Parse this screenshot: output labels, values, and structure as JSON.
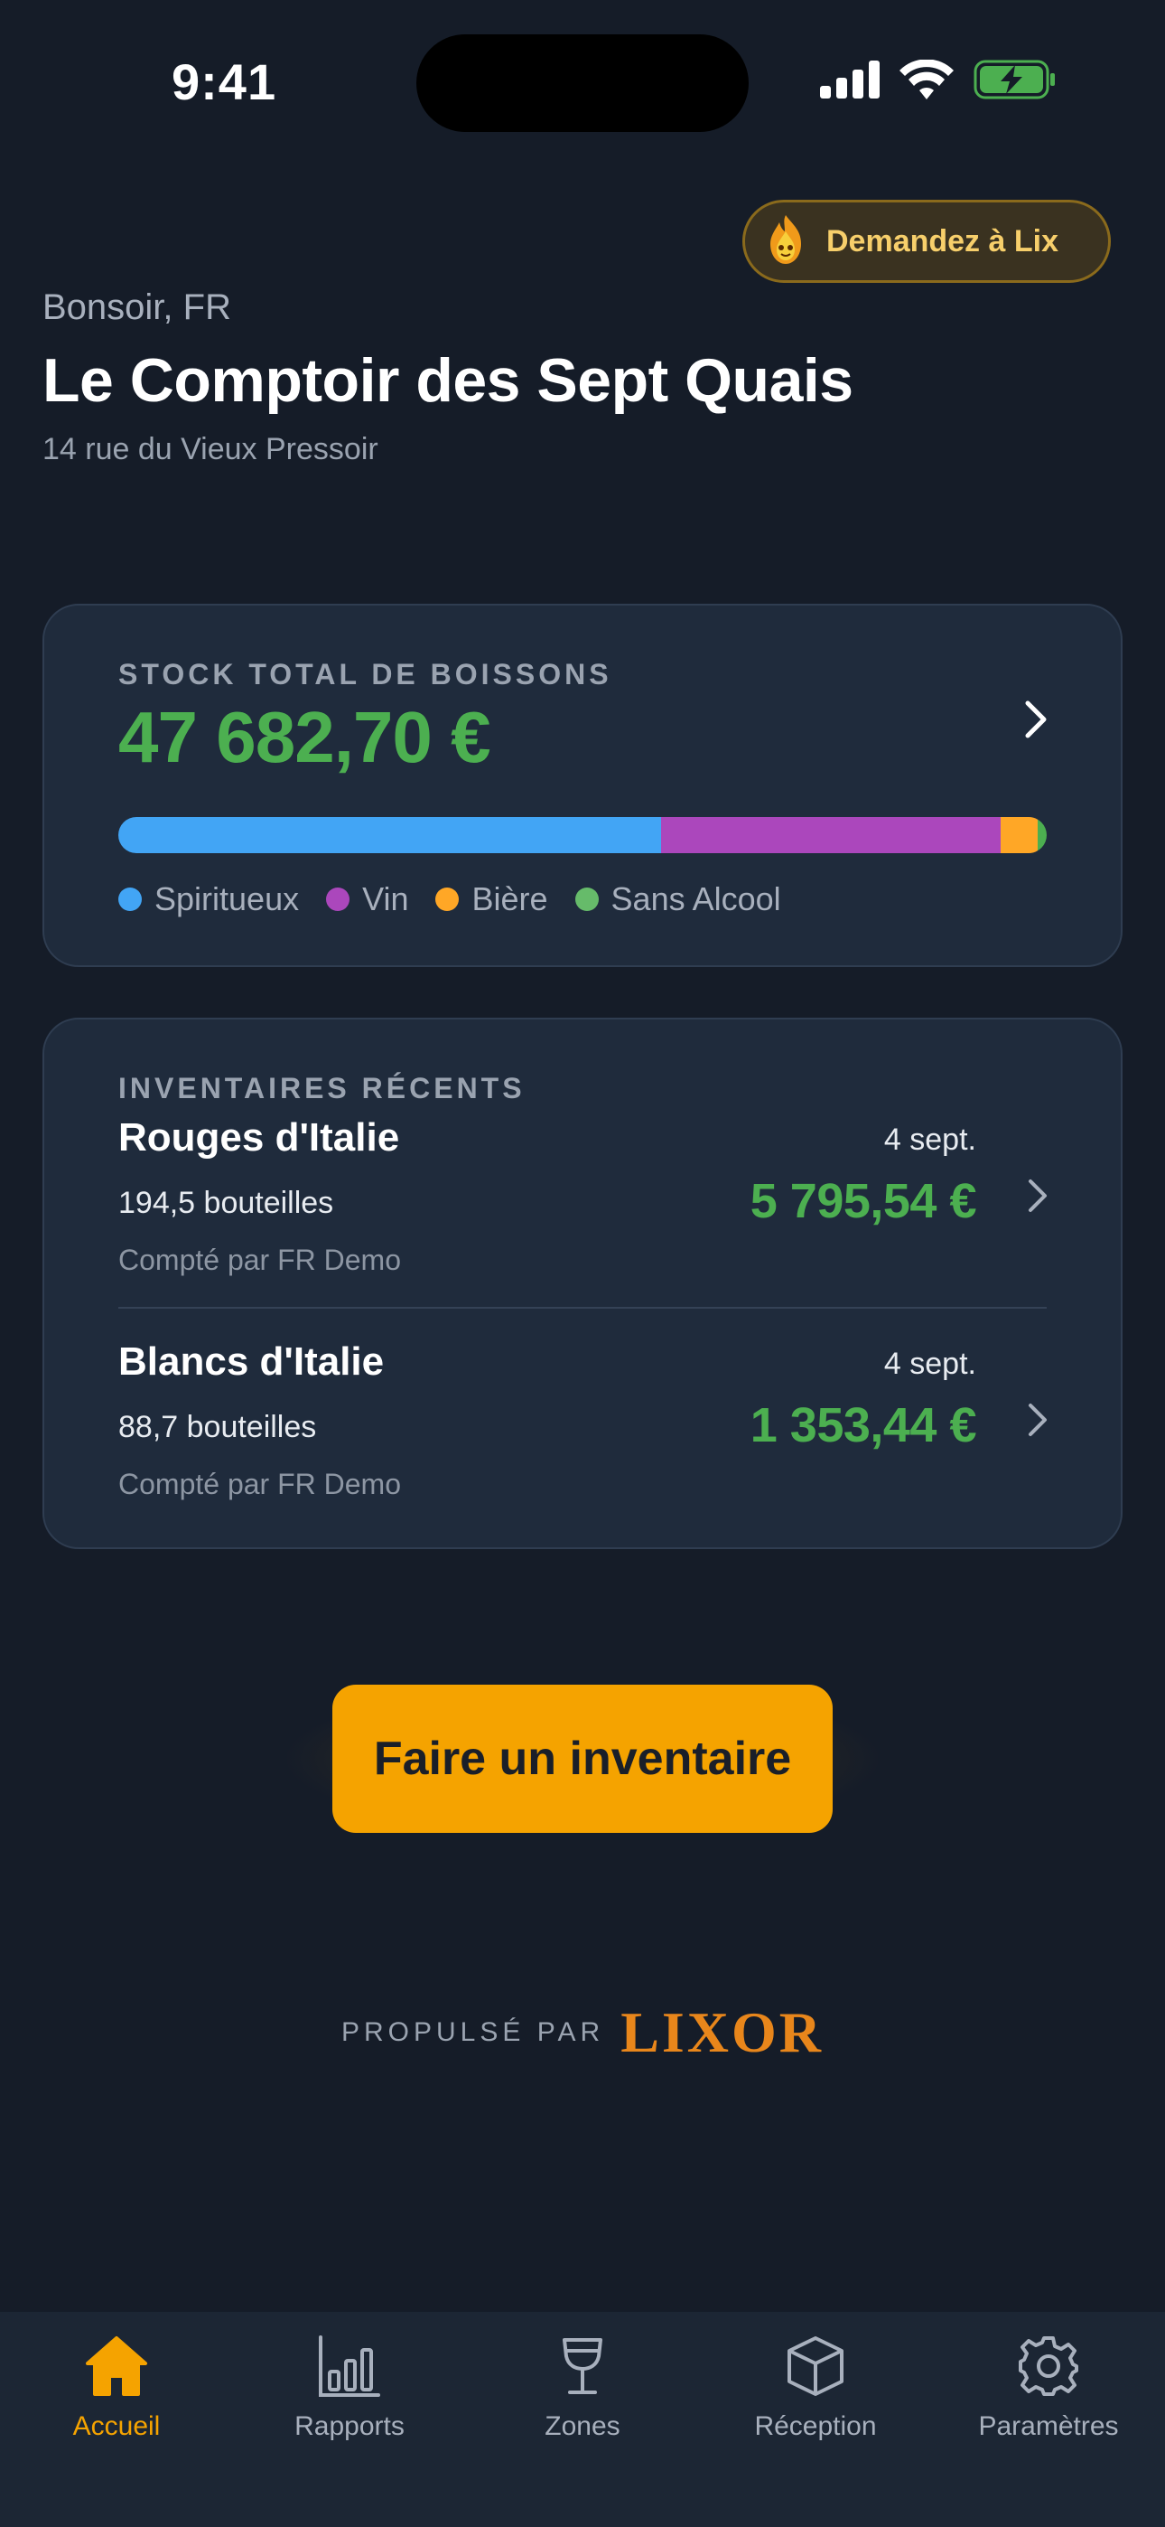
{
  "status_bar": {
    "time": "9:41"
  },
  "ask_button": {
    "label": "Demandez à Lix"
  },
  "header": {
    "greeting": "Bonsoir, FR",
    "venue_name": "Le Comptoir des Sept Quais",
    "address": "14 rue du Vieux Pressoir"
  },
  "stock_card": {
    "label": "STOCK TOTAL DE BOISSONS",
    "value": "47 682,70 €",
    "breakdown": [
      {
        "name": "Spiritueux",
        "share": 0.585,
        "color": "#42a5f5"
      },
      {
        "name": "Vin",
        "share": 0.365,
        "color": "#ab47bc"
      },
      {
        "name": "Bière",
        "share": 0.04,
        "color": "#ffa726"
      },
      {
        "name": "Sans Alcool",
        "share": 0.01,
        "color": "#4caf50"
      }
    ],
    "legend": [
      {
        "label": "Spiritueux",
        "color": "#42a5f5"
      },
      {
        "label": "Vin",
        "color": "#ab47bc"
      },
      {
        "label": "Bière",
        "color": "#ffa726"
      },
      {
        "label": "Sans Alcool",
        "color": "#66bb6a"
      }
    ]
  },
  "recent_inventories": {
    "label": "INVENTAIRES RÉCENTS",
    "items": [
      {
        "name": "Rouges d'Italie",
        "date": "4 sept.",
        "bottles": "194,5 bouteilles",
        "value": "5 795,54 €",
        "counted_by": "Compté par FR Demo"
      },
      {
        "name": "Blancs d'Italie",
        "date": "4 sept.",
        "bottles": "88,7 bouteilles",
        "value": "1 353,44 €",
        "counted_by": "Compté par FR Demo"
      }
    ]
  },
  "cta": {
    "label": "Faire un inventaire"
  },
  "footer": {
    "powered_label": "PROPULSÉ PAR",
    "brand": "LIXOR"
  },
  "tabbar": {
    "tabs": [
      {
        "label": "Accueil",
        "icon": "home-icon",
        "active": true
      },
      {
        "label": "Rapports",
        "icon": "bar-chart-icon",
        "active": false
      },
      {
        "label": "Zones",
        "icon": "wine-glass-icon",
        "active": false
      },
      {
        "label": "Réception",
        "icon": "box-icon",
        "active": false
      },
      {
        "label": "Paramètres",
        "icon": "gear-icon",
        "active": false
      }
    ]
  },
  "colors": {
    "background": "#151c28",
    "card": "#1f2b3c",
    "accent": "#f5a300",
    "positive": "#4caf50",
    "muted_text": "#9aa3b0"
  }
}
